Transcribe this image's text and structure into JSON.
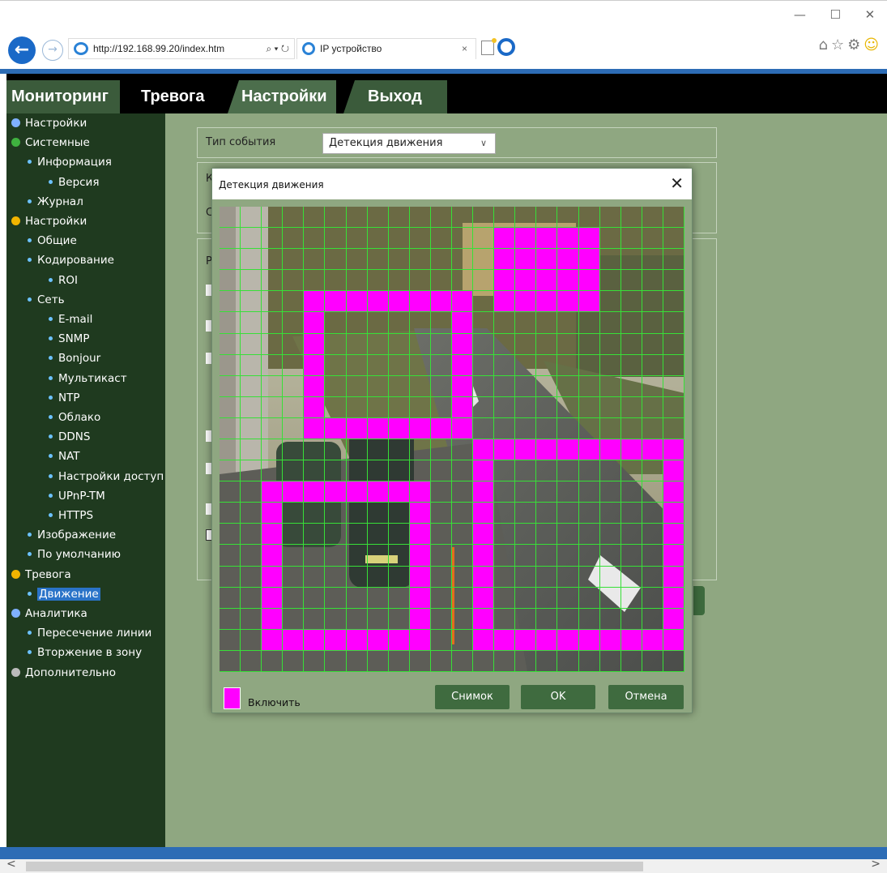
{
  "browser": {
    "url": "http://192.168.99.20/index.htm",
    "tab_title": "IP устройство",
    "close_glyph": "×",
    "icons": [
      "back-arrow-icon",
      "forward-arrow-icon",
      "ie-logo-icon",
      "search-icon",
      "refresh-icon",
      "new-tab-icon",
      "home-icon",
      "favorites-star-icon",
      "settings-gear-icon",
      "smiley-icon"
    ]
  },
  "nav": {
    "tabs": [
      {
        "label": "Мониторинг"
      },
      {
        "label": "Тревога"
      },
      {
        "label": "Настройки",
        "active": true
      },
      {
        "label": "Выход"
      }
    ]
  },
  "sidebar": {
    "items": [
      {
        "label": "Настройки",
        "level": 0,
        "icon": "book-icon"
      },
      {
        "label": "Системные",
        "level": 0,
        "icon": "info-icon"
      },
      {
        "label": "Информация",
        "level": 1
      },
      {
        "label": "Версия",
        "level": 2
      },
      {
        "label": "Журнал",
        "level": 1
      },
      {
        "label": "Настройки",
        "level": 0,
        "icon": "gear-icon"
      },
      {
        "label": "Общие",
        "level": 1
      },
      {
        "label": "Кодирование",
        "level": 1
      },
      {
        "label": "ROI",
        "level": 2
      },
      {
        "label": "Сеть",
        "level": 1
      },
      {
        "label": "E-mail",
        "level": 2
      },
      {
        "label": "SNMP",
        "level": 2
      },
      {
        "label": "Bonjour",
        "level": 2
      },
      {
        "label": "Мультикаст",
        "level": 2
      },
      {
        "label": "NTP",
        "level": 2
      },
      {
        "label": "Облако",
        "level": 2
      },
      {
        "label": "DDNS",
        "level": 2
      },
      {
        "label": "NAT",
        "level": 2
      },
      {
        "label": "Настройки доступ",
        "level": 2
      },
      {
        "label": "UPnP-TM",
        "level": 2
      },
      {
        "label": "HTTPS",
        "level": 2
      },
      {
        "label": "Изображение",
        "level": 1
      },
      {
        "label": "По умолчанию",
        "level": 1
      },
      {
        "label": "Тревога",
        "level": 0,
        "icon": "bell-icon"
      },
      {
        "label": "Движение",
        "level": 1,
        "selected": true
      },
      {
        "label": "Аналитика",
        "level": 0,
        "icon": "analytics-icon"
      },
      {
        "label": "Пересечение линии",
        "level": 1
      },
      {
        "label": "Вторжение в зону",
        "level": 1
      },
      {
        "label": "Дополнительно",
        "level": 0,
        "icon": "tools-icon"
      }
    ]
  },
  "main": {
    "event_type_label": "Тип события",
    "event_type_value": "Детекция движения",
    "row2_label_fragment": "К",
    "row2_second_fragment": "С",
    "row3_label_fragment": "Р"
  },
  "dialog": {
    "title": "Детекция движения",
    "close_glyph": "✕",
    "legend_label": "Включить",
    "snapshot_button": "Снимок",
    "ok_button": "OK",
    "cancel_button": "Отмена",
    "grid": {
      "rows": 22,
      "cols": 22,
      "active_cells": [
        [
          1,
          13
        ],
        [
          1,
          14
        ],
        [
          1,
          15
        ],
        [
          1,
          16
        ],
        [
          1,
          17
        ],
        [
          2,
          13
        ],
        [
          2,
          14
        ],
        [
          2,
          15
        ],
        [
          2,
          16
        ],
        [
          2,
          17
        ],
        [
          3,
          13
        ],
        [
          3,
          14
        ],
        [
          3,
          15
        ],
        [
          3,
          16
        ],
        [
          3,
          17
        ],
        [
          4,
          4
        ],
        [
          4,
          5
        ],
        [
          4,
          6
        ],
        [
          4,
          7
        ],
        [
          4,
          8
        ],
        [
          4,
          9
        ],
        [
          4,
          10
        ],
        [
          4,
          11
        ],
        [
          4,
          13
        ],
        [
          4,
          14
        ],
        [
          4,
          15
        ],
        [
          4,
          16
        ],
        [
          4,
          17
        ],
        [
          5,
          4
        ],
        [
          5,
          11
        ],
        [
          6,
          4
        ],
        [
          6,
          11
        ],
        [
          7,
          4
        ],
        [
          7,
          11
        ],
        [
          8,
          4
        ],
        [
          8,
          11
        ],
        [
          9,
          4
        ],
        [
          9,
          11
        ],
        [
          11,
          12
        ],
        [
          11,
          13
        ],
        [
          11,
          14
        ],
        [
          11,
          15
        ],
        [
          11,
          16
        ],
        [
          11,
          17
        ],
        [
          11,
          18
        ],
        [
          11,
          19
        ],
        [
          11,
          20
        ],
        [
          11,
          21
        ],
        [
          12,
          12
        ],
        [
          12,
          21
        ],
        [
          13,
          2
        ],
        [
          13,
          3
        ],
        [
          13,
          4
        ],
        [
          13,
          5
        ],
        [
          13,
          6
        ],
        [
          13,
          7
        ],
        [
          13,
          8
        ],
        [
          13,
          9
        ],
        [
          13,
          12
        ],
        [
          13,
          21
        ],
        [
          14,
          2
        ],
        [
          14,
          9
        ],
        [
          14,
          12
        ],
        [
          14,
          21
        ],
        [
          15,
          2
        ],
        [
          15,
          9
        ],
        [
          15,
          12
        ],
        [
          15,
          21
        ],
        [
          16,
          2
        ],
        [
          16,
          9
        ],
        [
          16,
          12
        ],
        [
          16,
          21
        ],
        [
          17,
          2
        ],
        [
          17,
          9
        ],
        [
          17,
          12
        ],
        [
          17,
          21
        ],
        [
          18,
          2
        ],
        [
          18,
          9
        ],
        [
          18,
          12
        ],
        [
          18,
          21
        ],
        [
          19,
          2
        ],
        [
          19,
          9
        ],
        [
          19,
          12
        ],
        [
          19,
          21
        ],
        [
          20,
          2
        ],
        [
          20,
          3
        ],
        [
          20,
          4
        ],
        [
          20,
          5
        ],
        [
          20,
          6
        ],
        [
          20,
          7
        ],
        [
          20,
          8
        ],
        [
          20,
          9
        ],
        [
          20,
          12
        ],
        [
          20,
          13
        ],
        [
          20,
          14
        ],
        [
          20,
          15
        ],
        [
          20,
          16
        ],
        [
          20,
          17
        ],
        [
          20,
          18
        ],
        [
          20,
          19
        ],
        [
          20,
          20
        ],
        [
          20,
          21
        ],
        [
          10,
          4
        ],
        [
          10,
          5
        ],
        [
          10,
          6
        ],
        [
          10,
          7
        ],
        [
          10,
          8
        ],
        [
          10,
          9
        ],
        [
          10,
          10
        ],
        [
          10,
          11
        ]
      ]
    }
  },
  "colors": {
    "header_bg": "#000000",
    "sidebar_bg": "#1f3a1f",
    "content_bg": "#8fa781",
    "button_bg": "#3f6b3f",
    "grid_line": "#37e037",
    "active_cell": "#ff00ff",
    "selection": "#2a73c8"
  }
}
